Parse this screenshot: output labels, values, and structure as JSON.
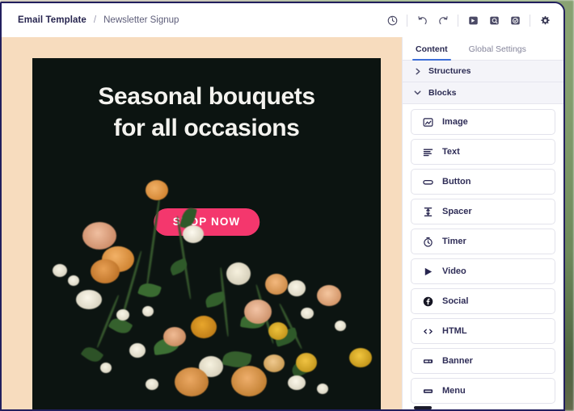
{
  "window": {
    "border_color": "#221f5e",
    "canvas_bg": "#f7dcbe"
  },
  "topbar": {
    "breadcrumb": {
      "root": "Email Template",
      "separator": "/",
      "leaf": "Newsletter Signup"
    },
    "actions": [
      {
        "name": "version-history-icon",
        "tooltip": "Version history"
      },
      {
        "name": "undo-icon",
        "tooltip": "Undo"
      },
      {
        "name": "redo-icon",
        "tooltip": "Redo"
      },
      {
        "name": "desktop-preview-icon",
        "tooltip": "Desktop preview"
      },
      {
        "name": "mobile-preview-icon",
        "tooltip": "Mobile preview"
      },
      {
        "name": "check-preview-icon",
        "tooltip": "Preview and test"
      },
      {
        "name": "settings-gear-icon",
        "tooltip": "Settings"
      }
    ]
  },
  "email": {
    "heading": "Seasonal bouquets\nfor all occasions",
    "cta_label": "SHOP NOW",
    "cta_color": "#f4376d",
    "background_color": "#0c1411",
    "image_alt": "Flower bouquet on dark background"
  },
  "panel": {
    "tabs": [
      {
        "label": "Content",
        "active": true
      },
      {
        "label": "Global Settings",
        "active": false
      }
    ],
    "accent_color": "#3d6fd8",
    "sections": [
      {
        "title": "Structures",
        "expanded": false,
        "chevron": "chevron-right-icon"
      },
      {
        "title": "Blocks",
        "expanded": true,
        "chevron": "chevron-down-icon"
      }
    ],
    "blocks": [
      {
        "label": "Image",
        "icon": "image-icon"
      },
      {
        "label": "Text",
        "icon": "text-lines-icon"
      },
      {
        "label": "Button",
        "icon": "button-pill-icon"
      },
      {
        "label": "Spacer",
        "icon": "spacer-icon"
      },
      {
        "label": "Timer",
        "icon": "timer-clock-icon"
      },
      {
        "label": "Video",
        "icon": "video-play-icon"
      },
      {
        "label": "Social",
        "icon": "social-facebook-icon"
      },
      {
        "label": "HTML",
        "icon": "code-brackets-icon"
      },
      {
        "label": "Banner",
        "icon": "banner-icon"
      },
      {
        "label": "Menu",
        "icon": "menu-bar-icon"
      }
    ]
  }
}
